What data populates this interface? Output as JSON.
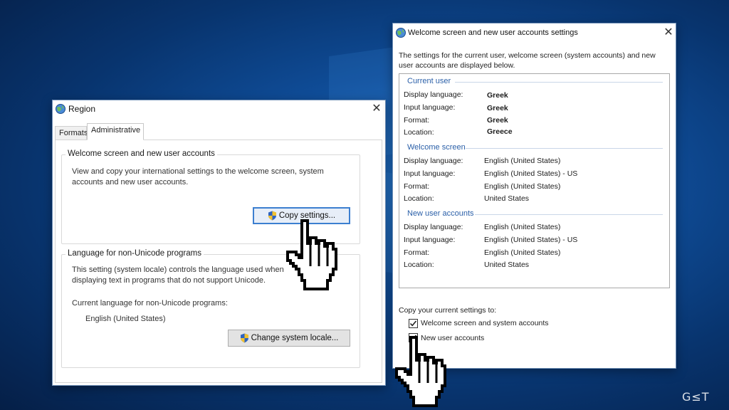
{
  "region_dialog": {
    "title": "Region",
    "close_glyph": "✕",
    "tabs": [
      {
        "label": "Formats",
        "active": false
      },
      {
        "label": "Administrative",
        "active": true
      }
    ],
    "welcome_group": {
      "legend": "Welcome screen and new user accounts",
      "description": "View and copy your international settings to the welcome screen, system accounts and new user accounts.",
      "copy_button": "Copy settings..."
    },
    "unicode_group": {
      "legend": "Language for non-Unicode programs",
      "description": "This setting (system locale) controls the language used when displaying text in programs that do not support Unicode.",
      "current_label": "Current language for non-Unicode programs:",
      "current_value": "English (United States)",
      "change_button": "Change system locale..."
    }
  },
  "welcome_dialog": {
    "title": "Welcome screen and new user accounts settings",
    "close_glyph": "✕",
    "intro": "The settings for the current user, welcome screen (system accounts) and new user accounts are displayed below.",
    "sections": [
      {
        "heading": "Current user",
        "rows": [
          {
            "label": "Display language:",
            "value": "Greek"
          },
          {
            "label": "Input language:",
            "value": "Greek"
          },
          {
            "label": "Format:",
            "value": "Greek"
          },
          {
            "label": "Location:",
            "value": "Greece"
          }
        ]
      },
      {
        "heading": "Welcome screen",
        "rows": [
          {
            "label": "Display language:",
            "value": "English (United States)"
          },
          {
            "label": "Input language:",
            "value": "English (United States) - US"
          },
          {
            "label": "Format:",
            "value": "English (United States)"
          },
          {
            "label": "Location:",
            "value": "United States"
          }
        ]
      },
      {
        "heading": "New user accounts",
        "rows": [
          {
            "label": "Display language:",
            "value": "English (United States)"
          },
          {
            "label": "Input language:",
            "value": "English (United States) - US"
          },
          {
            "label": "Format:",
            "value": "English (United States)"
          },
          {
            "label": "Location:",
            "value": "United States"
          }
        ]
      }
    ],
    "copy_to_label": "Copy your current settings to:",
    "checkboxes": [
      {
        "label": "Welcome screen and system accounts",
        "checked": true
      },
      {
        "label": "New user accounts",
        "checked": true
      }
    ]
  },
  "watermark": "G≤T",
  "icons": {
    "region_icon": "globe-icon",
    "welcome_icon": "globe-icon",
    "button_icon": "uac-shield-icon",
    "cursor_icon": "hand-pointer-icon"
  },
  "colors": {
    "desktop_bg": "#0f4c97",
    "section_heading": "#2a5fa8",
    "focus_border": "#3c7fd0"
  }
}
